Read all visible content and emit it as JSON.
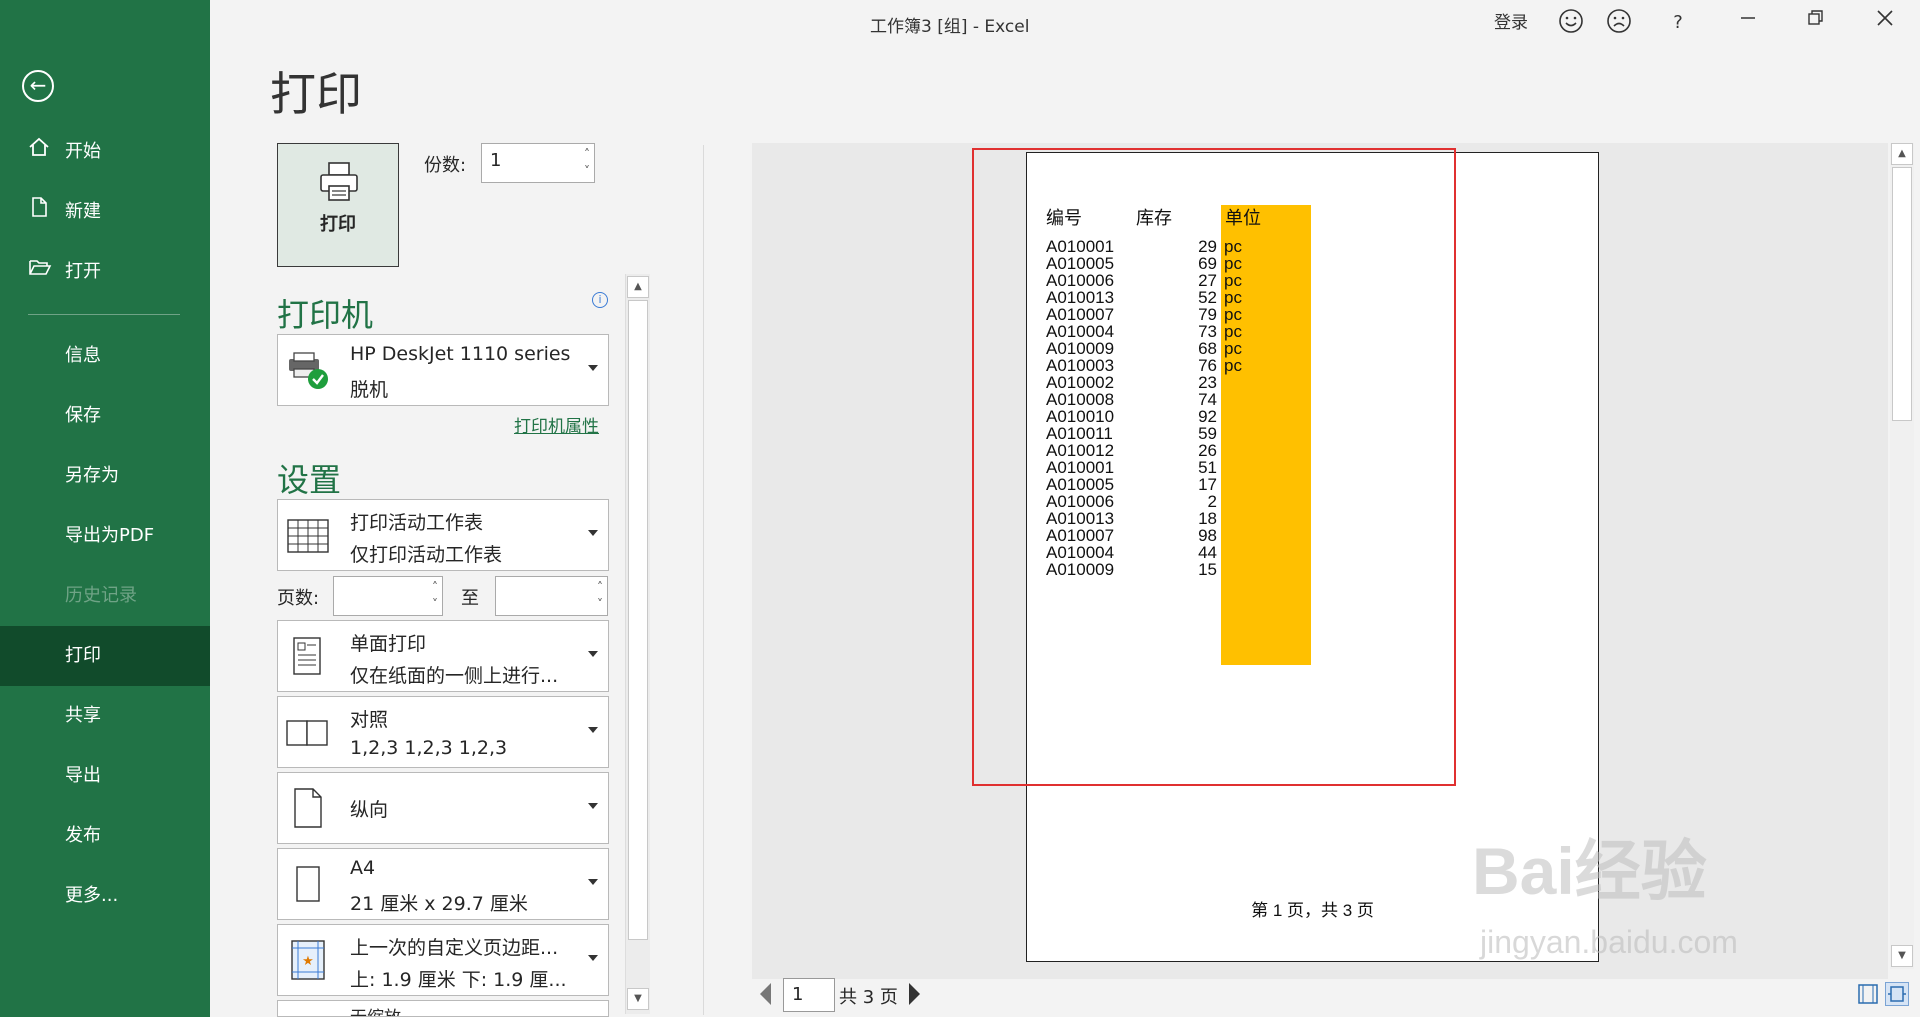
{
  "window": {
    "title": "工作簿3  [组]  -  Excel",
    "signin": "登录",
    "help": "?"
  },
  "nav": {
    "items": [
      {
        "label": "开始",
        "icon": "home-icon"
      },
      {
        "label": "新建",
        "icon": "new-file-icon"
      },
      {
        "label": "打开",
        "icon": "folder-open-icon"
      },
      {
        "label": "信息"
      },
      {
        "label": "保存"
      },
      {
        "label": "另存为"
      },
      {
        "label": "导出为PDF"
      },
      {
        "label": "历史记录",
        "disabled": true
      },
      {
        "label": "打印",
        "active": true
      },
      {
        "label": "共享"
      },
      {
        "label": "导出"
      },
      {
        "label": "发布"
      },
      {
        "label": "更多..."
      }
    ]
  },
  "print": {
    "heading": "打印",
    "button_label": "打印",
    "copies_label": "份数:",
    "copies_value": "1",
    "printer_heading": "打印机",
    "printer_name": "HP DeskJet 1110 series",
    "printer_status": "脱机",
    "printer_properties": "打印机属性",
    "settings_heading": "设置",
    "scope": {
      "line1": "打印活动工作表",
      "line2": "仅打印活动工作表"
    },
    "pages_label": "页数:",
    "pages_to": "至",
    "sides": {
      "line1": "单面打印",
      "line2": "仅在纸面的一侧上进行..."
    },
    "collate": {
      "line1": "对照",
      "line2": "1,2,3    1,2,3    1,2,3"
    },
    "orientation": {
      "line1": "纵向"
    },
    "paper": {
      "line1": "A4",
      "line2": "21 厘米 x 29.7 厘米"
    },
    "margins": {
      "line1": "上一次的自定义页边距...",
      "line2": "上: 1.9 厘米 下: 1.9 厘..."
    },
    "scaling": {
      "line1": "无缩放"
    }
  },
  "preview": {
    "headers": {
      "code": "编号",
      "stock": "库存",
      "unit": "单位"
    },
    "rows": [
      {
        "code": "A010001",
        "stock": "29",
        "unit": "pc"
      },
      {
        "code": "A010005",
        "stock": "69",
        "unit": "pc"
      },
      {
        "code": "A010006",
        "stock": "27",
        "unit": "pc"
      },
      {
        "code": "A010013",
        "stock": "52",
        "unit": "pc"
      },
      {
        "code": "A010007",
        "stock": "79",
        "unit": "pc"
      },
      {
        "code": "A010004",
        "stock": "73",
        "unit": "pc"
      },
      {
        "code": "A010009",
        "stock": "68",
        "unit": "pc"
      },
      {
        "code": "A010003",
        "stock": "76",
        "unit": "pc"
      },
      {
        "code": "A010002",
        "stock": "23",
        "unit": ""
      },
      {
        "code": "A010008",
        "stock": "74",
        "unit": ""
      },
      {
        "code": "A010010",
        "stock": "92",
        "unit": ""
      },
      {
        "code": "A010011",
        "stock": "59",
        "unit": ""
      },
      {
        "code": "A010012",
        "stock": "26",
        "unit": ""
      },
      {
        "code": "A010001",
        "stock": "51",
        "unit": ""
      },
      {
        "code": "A010005",
        "stock": "17",
        "unit": ""
      },
      {
        "code": "A010006",
        "stock": "2",
        "unit": ""
      },
      {
        "code": "A010013",
        "stock": "18",
        "unit": ""
      },
      {
        "code": "A010007",
        "stock": "98",
        "unit": ""
      },
      {
        "code": "A010004",
        "stock": "44",
        "unit": ""
      },
      {
        "code": "A010009",
        "stock": "15",
        "unit": ""
      }
    ],
    "page_footer": "第 1 页，共 3 页",
    "unit_column_color": "#ffc000",
    "highlight_color": "#e03030"
  },
  "pager": {
    "current": "1",
    "total": "共 3 页"
  },
  "watermark": {
    "brand": "Bai经验",
    "url": "jingyan.baidu.com"
  },
  "colors": {
    "nav_bg": "#217346",
    "nav_active": "#114b2b",
    "accent": "#217346"
  }
}
